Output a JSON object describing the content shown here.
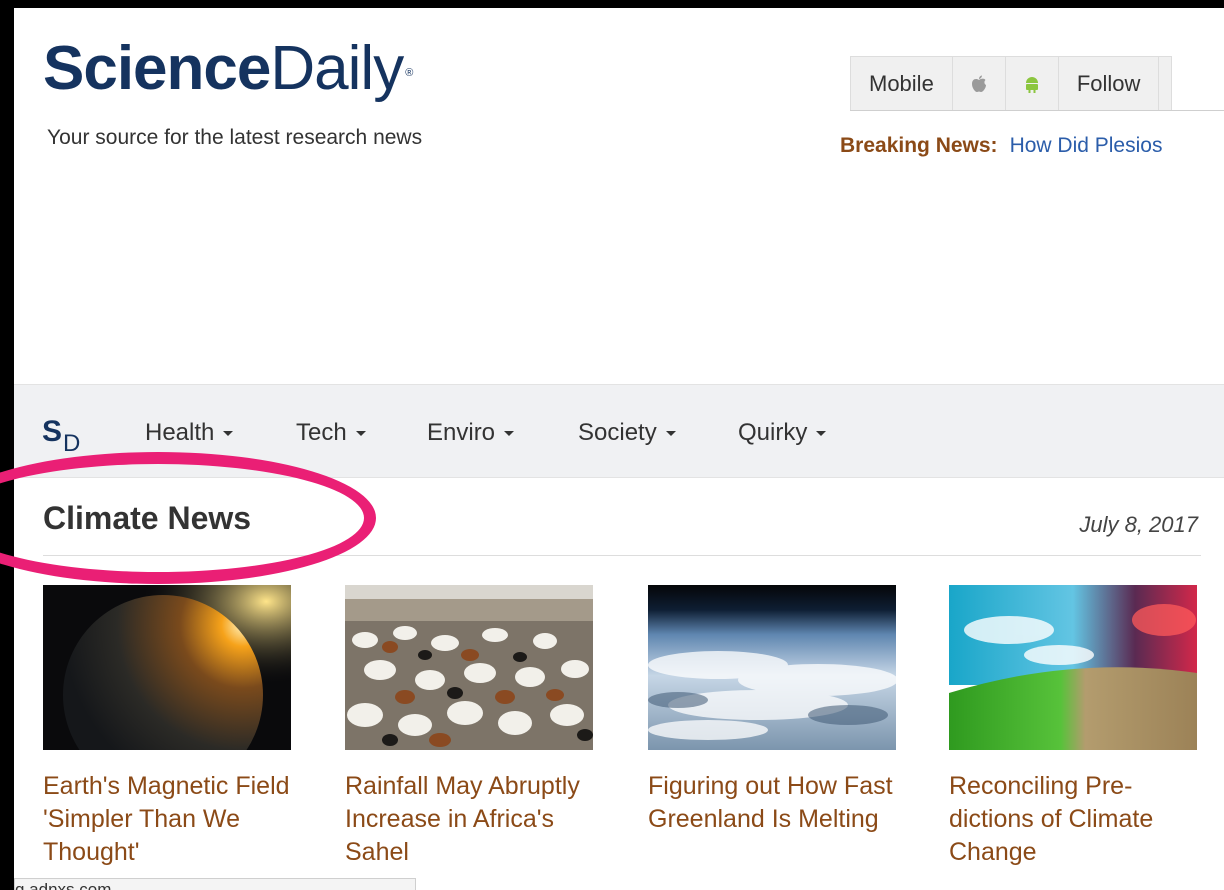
{
  "header": {
    "logo_bold": "Science",
    "logo_light": "Daily",
    "logo_reg": "®",
    "tagline": "Your source for the latest research news"
  },
  "topbar": {
    "mobile_label": "Mobile",
    "apple_icon": "apple-icon",
    "android_icon": "android-icon",
    "follow_label": "Follow"
  },
  "breaking": {
    "label": "Breaking News:",
    "headline": "How Did Plesios"
  },
  "nav": {
    "brand_s": "S",
    "brand_d": "D",
    "items": [
      "Health",
      "Tech",
      "Enviro",
      "Society",
      "Quirky"
    ]
  },
  "section": {
    "title": "Climate News",
    "date": "July 8, 2017"
  },
  "cards": [
    {
      "title": "Earth's Magnetic Field 'Simpler Than We Thought'"
    },
    {
      "title": "Rainfall May Abruptly Increase in Africa's Sahel"
    },
    {
      "title": "Figuring out How Fast Greenland Is Melting"
    },
    {
      "title": "Reconciling Pre-dictions of Climate Change"
    }
  ],
  "statusbar": {
    "text": "g.adnxs.com..."
  },
  "colors": {
    "brand": "#15335f",
    "headline": "#8b4a17",
    "link": "#2b5daa",
    "highlight": "#ea1f75"
  }
}
